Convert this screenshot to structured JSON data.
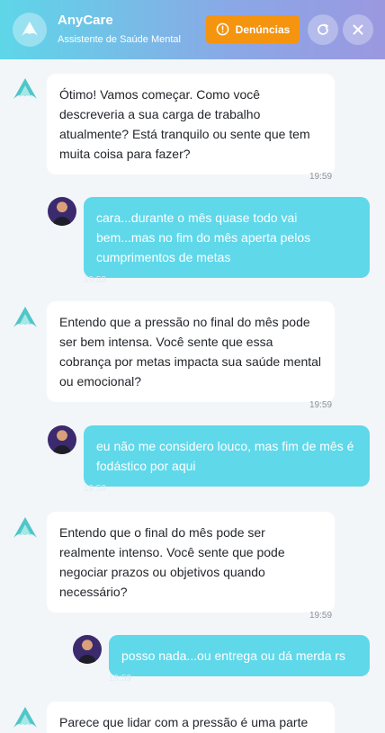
{
  "header": {
    "title": "AnyCare",
    "subtitle": "Assistente de Saúde Mental",
    "report_label": "Denúncias"
  },
  "colors": {
    "accent": "#5fd8ea",
    "report": "#f5940f",
    "bot_bubble": "#ffffff"
  },
  "messages": [
    {
      "from": "bot",
      "text": "Ótimo! Vamos começar. Como você descreveria a sua carga de trabalho atualmente? Está tranquilo ou sente que tem muita coisa para fazer?",
      "time": "19:59"
    },
    {
      "from": "user",
      "text": "cara...durante o mês quase todo vai bem...mas no fim do mês aperta pelos cumprimentos de metas",
      "time": "19:59"
    },
    {
      "from": "bot",
      "text": "Entendo que a pressão no final do mês pode ser bem intensa. Você sente que essa cobrança por metas impacta sua saúde mental ou emocional?",
      "time": "19:59"
    },
    {
      "from": "user",
      "text": "eu não me considero louco, mas fim de mês é fodástico por aqui",
      "time": "19:59"
    },
    {
      "from": "bot",
      "text": "Entendo que o final do mês pode ser realmente intenso. Você sente que pode negociar prazos ou objetivos quando necessário?",
      "time": "19:59"
    },
    {
      "from": "user",
      "text": "posso nada...ou entrega ou dá merda rs",
      "time": "19:59"
    },
    {
      "from": "bot",
      "text": "Parece que lidar com a pressão é uma parte",
      "time": ""
    }
  ]
}
